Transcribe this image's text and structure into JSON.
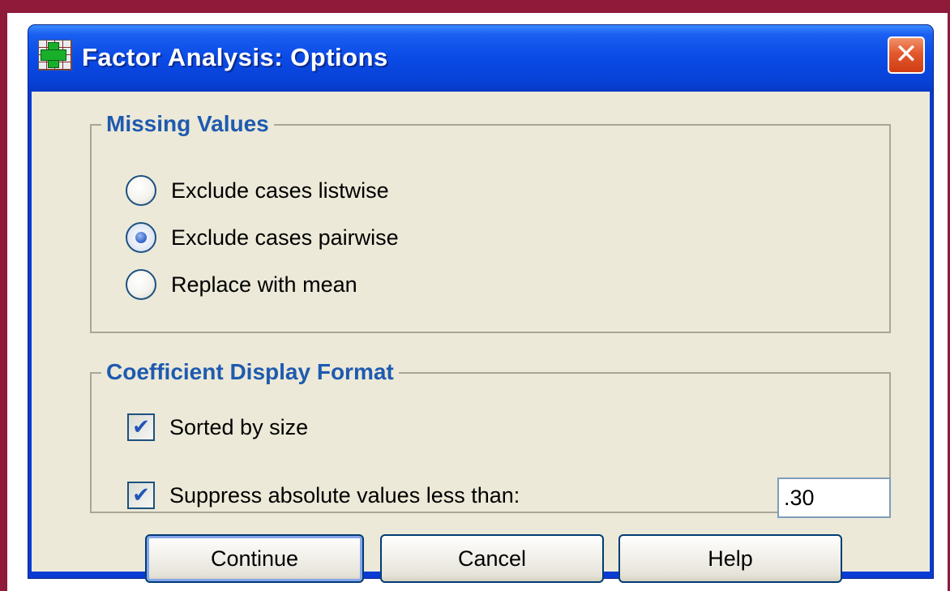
{
  "window": {
    "title": "Factor Analysis: Options",
    "app_icon": "spss-data-grid-icon",
    "close_glyph": "✕"
  },
  "missing_values": {
    "title": "Missing Values",
    "options": [
      {
        "label": "Exclude cases listwise",
        "checked": false
      },
      {
        "label": "Exclude cases pairwise",
        "checked": true
      },
      {
        "label": "Replace with mean",
        "checked": false
      }
    ]
  },
  "coefficient_display": {
    "title": "Coefficient Display Format",
    "sorted_by_size": {
      "label": "Sorted by size",
      "checked": true
    },
    "suppress": {
      "label": "Suppress absolute values less than:",
      "checked": true,
      "value": ".30"
    }
  },
  "buttons": {
    "continue": "Continue",
    "cancel": "Cancel",
    "help": "Help"
  },
  "colors": {
    "frame": "#8f1a3a",
    "titlebar": "#0a4ae6",
    "dialog_bg": "#ece9d8",
    "group_title": "#1e5ab0"
  }
}
